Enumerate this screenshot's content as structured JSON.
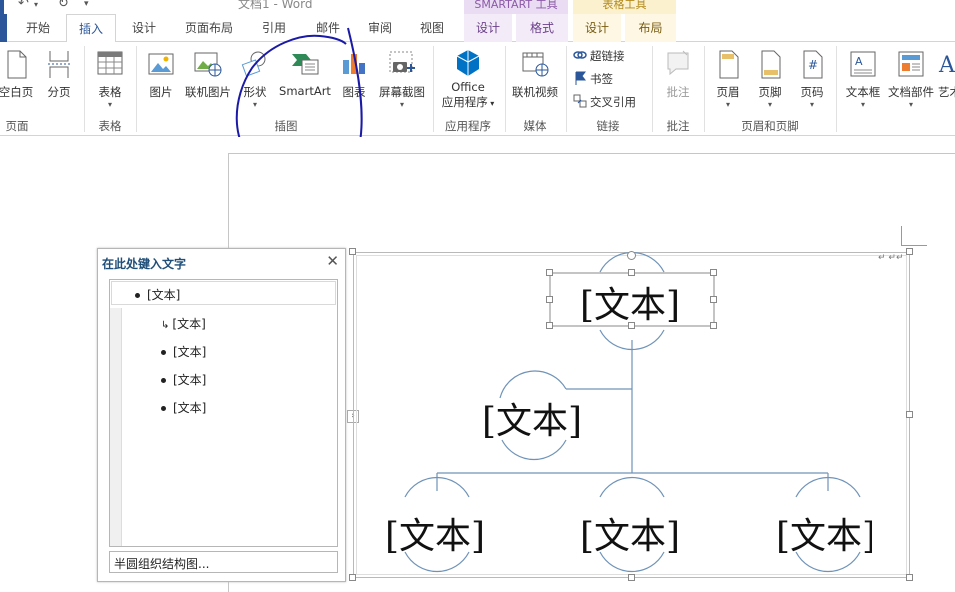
{
  "titlebar": {
    "title": "文档1 - Word",
    "undo_icon": "undo-icon",
    "redo_icon": "redo-icon",
    "customize_icon": "customize-quick-access-icon",
    "contextual_smartart": "SMARTART 工具",
    "contextual_table": "表格工具"
  },
  "tabs": [
    {
      "label": "开始"
    },
    {
      "label": "插入"
    },
    {
      "label": "设计"
    },
    {
      "label": "页面布局"
    },
    {
      "label": "引用"
    },
    {
      "label": "邮件"
    },
    {
      "label": "审阅"
    },
    {
      "label": "视图"
    },
    {
      "label": "设计"
    },
    {
      "label": "格式"
    },
    {
      "label": "设计"
    },
    {
      "label": "布局"
    }
  ],
  "ribbon": {
    "pages": {
      "blank_page": "空白页",
      "page_break": "分页",
      "label": "页面"
    },
    "tables": {
      "table": "表格",
      "label": "表格"
    },
    "illustrations": {
      "pictures": "图片",
      "online_pictures": "联机图片",
      "shapes": "形状",
      "smartart": "SmartArt",
      "chart": "图表",
      "screenshot": "屏幕截图",
      "label": "插图"
    },
    "apps": {
      "office_line1": "Office",
      "office_line2": "应用程序",
      "label": "应用程序"
    },
    "media": {
      "online_video": "联机视频",
      "label": "媒体"
    },
    "links": {
      "hyperlink": "超链接",
      "bookmark": "书签",
      "cross_ref": "交叉引用",
      "label": "链接"
    },
    "comments": {
      "comment": "批注",
      "label": "批注"
    },
    "header_footer": {
      "header": "页眉",
      "footer": "页脚",
      "page_number": "页码",
      "label": "页眉和页脚"
    },
    "text": {
      "textbox": "文本框",
      "quick_parts": "文档部件",
      "wordart": "艺术"
    }
  },
  "colors": {
    "accent": "#2b579a",
    "annotation_stroke": "#1a1aa6",
    "connector": "#6f93b8",
    "smartart_tab": "#8b5aa8",
    "table_tab": "#b38a1c"
  },
  "text_pane": {
    "title": "在此处键入文字",
    "items": [
      "[文本]",
      "[文本]",
      "[文本]",
      "[文本]",
      "[文本]"
    ],
    "footer": "半圆组织结构图..."
  },
  "smartart": {
    "nodes": [
      "[文本]",
      "[文本]",
      "[文本]",
      "[文本]",
      "[文本]"
    ]
  }
}
